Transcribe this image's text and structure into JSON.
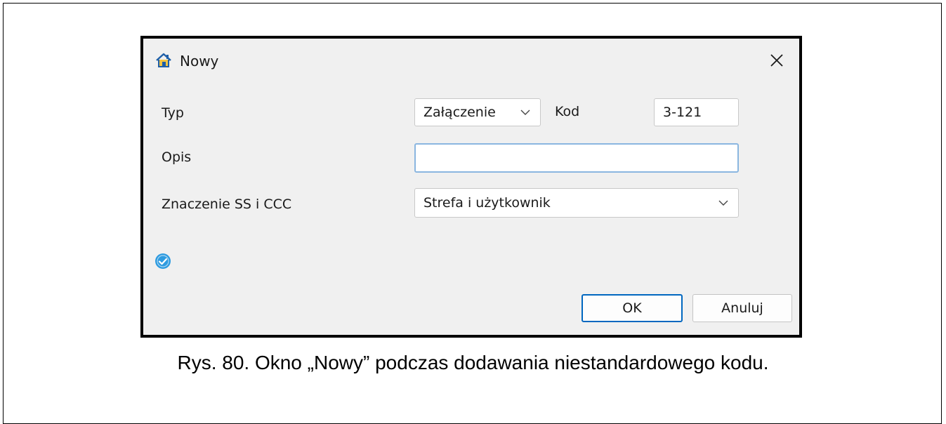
{
  "dialog": {
    "title": "Nowy",
    "close_label": "×",
    "type_label": "Typ",
    "type_value": "Załączenie",
    "code_label": "Kod",
    "code_value": "3-121",
    "description_label": "Opis",
    "description_value": "",
    "meaning_label": "Znaczenie SS i CCC",
    "meaning_value": "Strefa i użytkownik",
    "ok_label": "OK",
    "cancel_label": "Anuluj",
    "icons": {
      "title": "home-icon",
      "close": "close-icon",
      "dropdown": "chevron-down-icon",
      "status": "check-circle-icon"
    },
    "colors": {
      "background": "#f0f0f0",
      "accent": "#0067c0",
      "focus_border": "#8ab6e0",
      "status_icon": "#2e9be0"
    }
  },
  "caption": "Rys. 80. Okno „Nowy” podczas dodawania niestandardowego kodu."
}
